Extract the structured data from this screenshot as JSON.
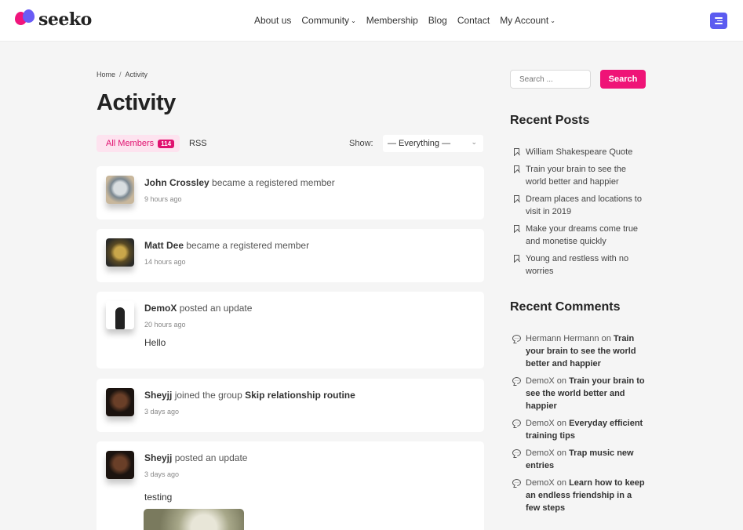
{
  "header": {
    "logo_text": "seeko",
    "nav": [
      {
        "label": "About us",
        "has_dropdown": false
      },
      {
        "label": "Community",
        "has_dropdown": true
      },
      {
        "label": "Membership",
        "has_dropdown": false
      },
      {
        "label": "Blog",
        "has_dropdown": false
      },
      {
        "label": "Contact",
        "has_dropdown": false
      },
      {
        "label": "My Account",
        "has_dropdown": true
      }
    ],
    "menu_icon": "filter-menu-icon",
    "accent_color": "#5b5bf0"
  },
  "main": {
    "breadcrumb": {
      "home": "Home",
      "separator": "/",
      "current": "Activity"
    },
    "title": "Activity",
    "tabs": {
      "all_members_label": "All Members",
      "all_members_count": "114",
      "rss_label": "RSS"
    },
    "show": {
      "label": "Show:",
      "selected": "— Everything —"
    },
    "activities": [
      {
        "user": "John Crossley",
        "action": "became a registered member",
        "target": "",
        "time": "9 hours ago",
        "content": ""
      },
      {
        "user": "Matt Dee",
        "action": "became a registered member",
        "target": "",
        "time": "14 hours ago",
        "content": ""
      },
      {
        "user": "DemoX",
        "action": "posted an update",
        "target": "",
        "time": "20 hours ago",
        "content": "Hello"
      },
      {
        "user": "Sheyjj",
        "action": "joined the group",
        "target": "Skip relationship routine",
        "time": "3 days ago",
        "content": ""
      },
      {
        "user": "Sheyjj",
        "action": "posted an update",
        "target": "",
        "time": "3 days ago",
        "content": "testing"
      }
    ],
    "brand_color": "#ef1477"
  },
  "sidebar": {
    "search": {
      "placeholder": "Search ...",
      "button": "Search"
    },
    "recent_posts": {
      "title": "Recent Posts",
      "items": [
        "William Shakespeare Quote",
        "Train your brain to see the world better and happier",
        "Dream places and locations to visit in 2019",
        "Make your dreams come true and monetise quickly",
        "Young and restless with no worries"
      ]
    },
    "recent_comments": {
      "title": "Recent Comments",
      "items": [
        {
          "author": "Hermann Hermann",
          "on": "on",
          "post": "Train your brain to see the world better and happier"
        },
        {
          "author": "DemoX",
          "on": "on",
          "post": "Train your brain to see the world better and happier"
        },
        {
          "author": "DemoX",
          "on": "on",
          "post": "Everyday efficient training tips"
        },
        {
          "author": "DemoX",
          "on": "on",
          "post": "Trap music new entries"
        },
        {
          "author": "DemoX",
          "on": "on",
          "post": "Learn how to keep an endless friendship in a few steps"
        }
      ]
    }
  }
}
